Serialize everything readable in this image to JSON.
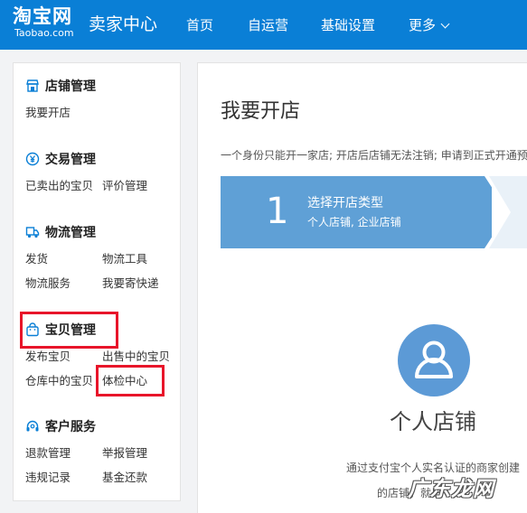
{
  "header": {
    "logo_main": "淘宝网",
    "logo_sub": "Taobao.com",
    "title": "卖家中心",
    "nav": [
      {
        "label": "首页"
      },
      {
        "label": "自运营"
      },
      {
        "label": "基础设置"
      },
      {
        "label": "更多"
      }
    ],
    "colors": {
      "bar": "#0a7fd6",
      "text": "#ffffff"
    }
  },
  "sidebar": {
    "sections": [
      {
        "title": "店铺管理",
        "icon": "store-icon",
        "links": [
          "我要开店"
        ]
      },
      {
        "title": "交易管理",
        "icon": "yen-icon",
        "links": [
          "已卖出的宝贝",
          "评价管理"
        ]
      },
      {
        "title": "物流管理",
        "icon": "truck-icon",
        "links": [
          "发货",
          "物流工具",
          "物流服务",
          "我要寄快递"
        ]
      },
      {
        "title": "宝贝管理",
        "icon": "bag-icon",
        "links": [
          "发布宝贝",
          "出售中的宝贝",
          "仓库中的宝贝",
          "体检中心"
        ]
      },
      {
        "title": "客户服务",
        "icon": "headset-icon",
        "links": [
          "退款管理",
          "举报管理",
          "违规记录",
          "基金还款"
        ]
      }
    ],
    "highlight_color": "#e8152a"
  },
  "main": {
    "title": "我要开店",
    "notice": "一个身份只能开一家店; 开店后店铺无法注销; 申请到正式开通预计",
    "steps": [
      {
        "number": "1",
        "title": "选择开店类型",
        "subtitle": "个人店铺, 企业店铺"
      }
    ],
    "shop_card": {
      "icon": "person-icon",
      "title": "个人店铺",
      "desc_line1": "通过支付宝个人实名认证的商家创建",
      "desc_line2": "的店铺，就是"
    }
  },
  "watermark": "广东龙网"
}
